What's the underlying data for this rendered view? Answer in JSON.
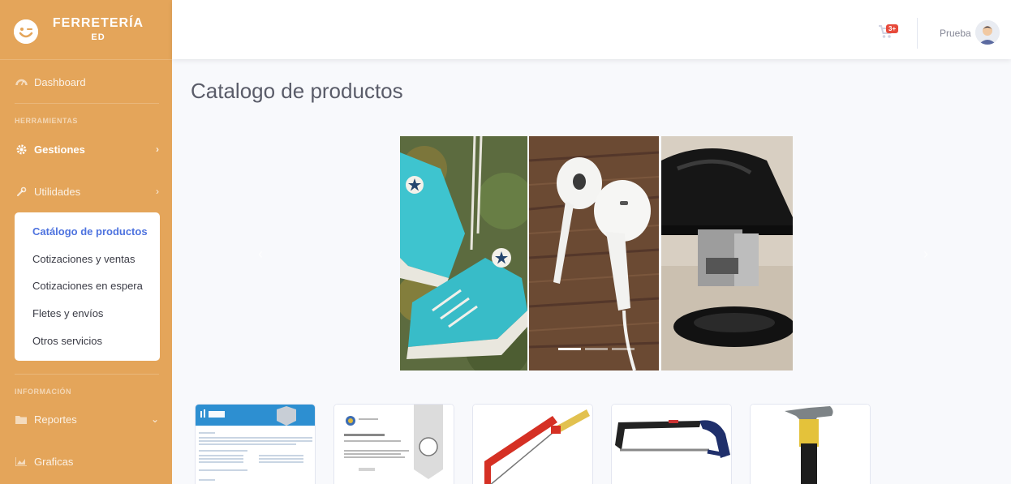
{
  "brand": {
    "name": "FERRETERÍA",
    "sub": "ED"
  },
  "sidebar": {
    "dashboard": "Dashboard",
    "section_tools": "HERRAMIENTAS",
    "gestiones": "Gestiones",
    "utilidades": "Utilidades",
    "submenu": [
      "Catálogo de productos",
      "Cotizaciones y ventas",
      "Cotizaciones en espera",
      "Fletes y envíos",
      "Otros servicios"
    ],
    "section_info": "INFORMACIÓN",
    "reportes": "Reportes",
    "graficas": "Graficas"
  },
  "topbar": {
    "cart_badge": "3+",
    "user_name": "Prueba"
  },
  "main": {
    "title": "Catalogo de productos"
  },
  "carousel": {
    "slides": [
      "sneakers-slide",
      "earphones-slide",
      "stapler-slide"
    ],
    "active_index": 0
  },
  "cards": [
    "ndg-certificate",
    "university-certificate",
    "coping-saw",
    "hacksaw",
    "claw-hammer"
  ],
  "colors": {
    "sidebar": "#e4a55a",
    "accent": "#4e73df",
    "badge": "#e74a3b"
  }
}
